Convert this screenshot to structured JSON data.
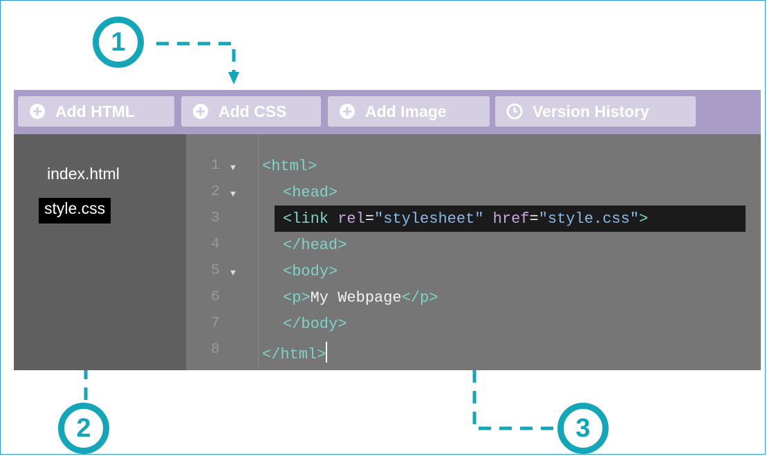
{
  "callouts": [
    "1",
    "2",
    "3"
  ],
  "toolbar": {
    "buttons": [
      {
        "label": "Add HTML",
        "icon": "plus-circle-icon"
      },
      {
        "label": "Add CSS",
        "icon": "plus-circle-icon"
      },
      {
        "label": "Add Image",
        "icon": "plus-circle-icon"
      },
      {
        "label": "Version History",
        "icon": "clock-icon"
      }
    ]
  },
  "files": [
    "index.html",
    "style.css"
  ],
  "selected_file": "style.css",
  "editor": {
    "line_numbers": [
      "1",
      "2",
      "3",
      "4",
      "5",
      "6",
      "7",
      "8"
    ],
    "lines": [
      [
        "<html>"
      ],
      [
        "<head>"
      ],
      [
        "<link",
        " rel",
        "=",
        "\"stylesheet\"",
        " href",
        "=",
        "\"style.css\"",
        ">"
      ],
      [
        "</head>"
      ],
      [
        "<body>"
      ],
      [
        "<p>",
        "My Webpage",
        "</p>"
      ],
      [
        "</body>"
      ],
      [
        "</html>"
      ]
    ],
    "fold_marker": "▼"
  },
  "colors": {
    "callout": "#14a6b8",
    "toolbar": "#a99cc6",
    "button": "#d4cfe2",
    "sidebar": "#5f5f5f",
    "editor": "#767676",
    "highlight": "#1b1b1b"
  }
}
